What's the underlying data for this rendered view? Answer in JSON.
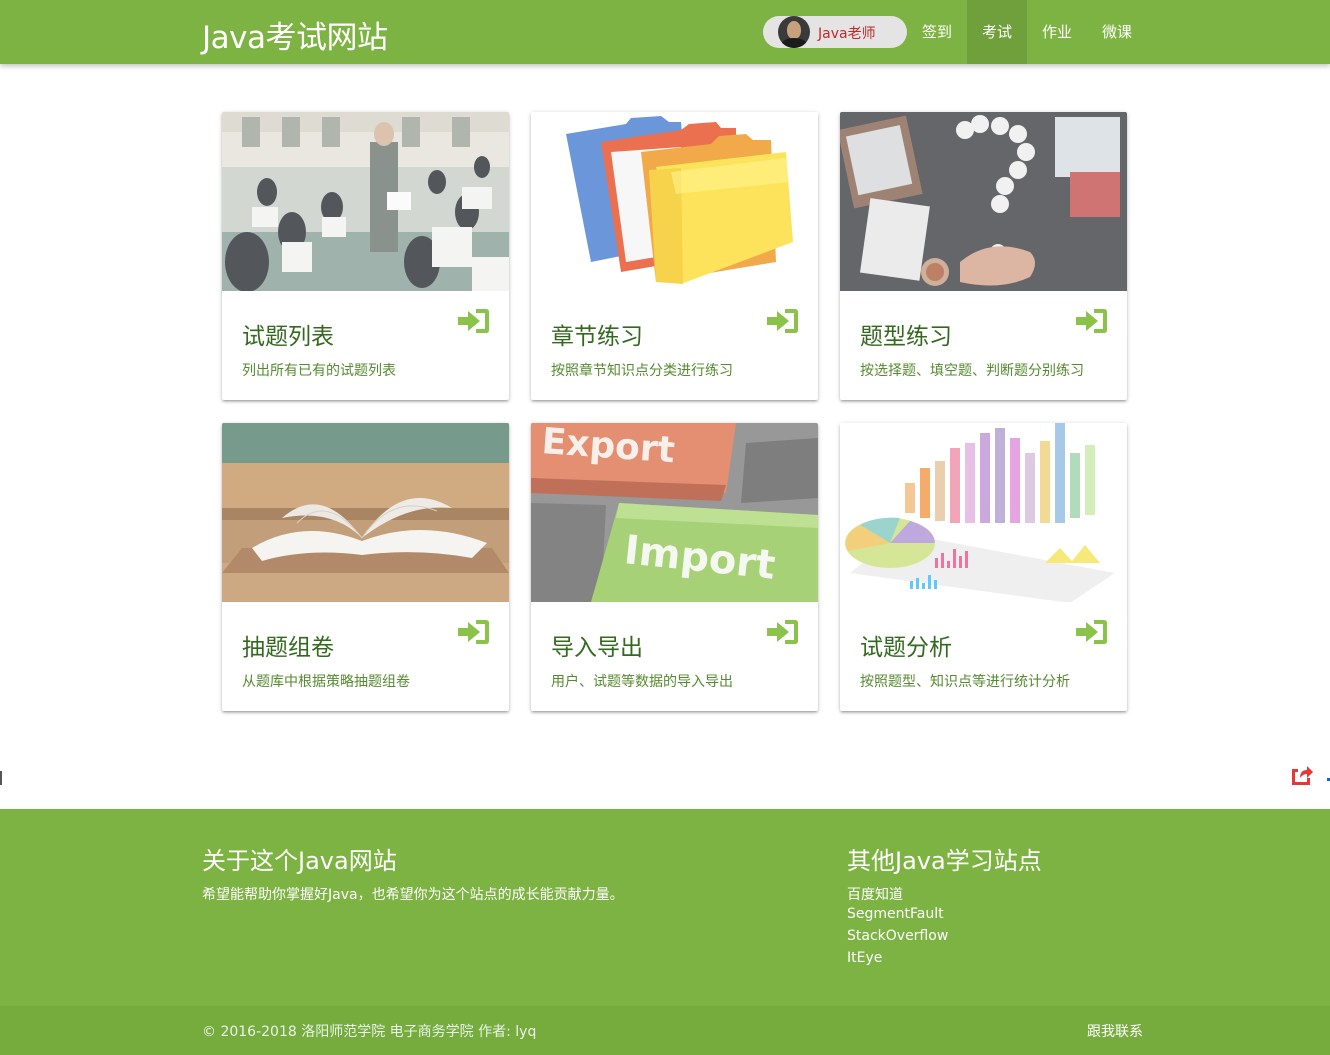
{
  "nav": {
    "brand": "Java考试网站",
    "user_name": "Java老师",
    "items": [
      {
        "label": "签到"
      },
      {
        "label": "考试"
      },
      {
        "label": "作业"
      },
      {
        "label": "微课"
      }
    ],
    "active_item": "考试"
  },
  "cards": [
    {
      "title": "试题列表",
      "desc": "列出所有已有的试题列表",
      "image": "exam-hall-photo"
    },
    {
      "title": "章节练习",
      "desc": "按照章节知识点分类进行练习",
      "image": "folders-photo"
    },
    {
      "title": "题型练习",
      "desc": "按选择题、填空题、判断题分别练习",
      "image": "question-mark-desk-photo"
    },
    {
      "title": "抽题组卷",
      "desc": "从题库中根据策略抽题组卷",
      "image": "open-book-desk-photo"
    },
    {
      "title": "导入导出",
      "desc": "用户、试题等数据的导入导出",
      "image": "export-import-keys-photo"
    },
    {
      "title": "试题分析",
      "desc": "按照题型、知识点等进行统计分析",
      "image": "bar-chart-3d-photo"
    }
  ],
  "footer": {
    "about_title": "关于这个Java网站",
    "about_text": "希望能帮助你掌握好Java，也希望你为这个站点的成长能贡献力量。",
    "links_title": "其他Java学习站点",
    "links": [
      "百度知道",
      "SegmentFault",
      "StackOverflow",
      "ItEye"
    ],
    "copyright": "© 2016-2018 洛阳师范学院 电子商务学院  作者: lyq",
    "contact": "跟我联系"
  },
  "colors": {
    "primary": "#7cb342",
    "title_text": "#33691e",
    "desc_text": "#558b2f",
    "enter_icon": "#8bc34a",
    "user_name": "#c62828",
    "share_icon": "#e53935"
  },
  "icons": {
    "enter": "sign-in-icon",
    "share": "share-icon"
  }
}
